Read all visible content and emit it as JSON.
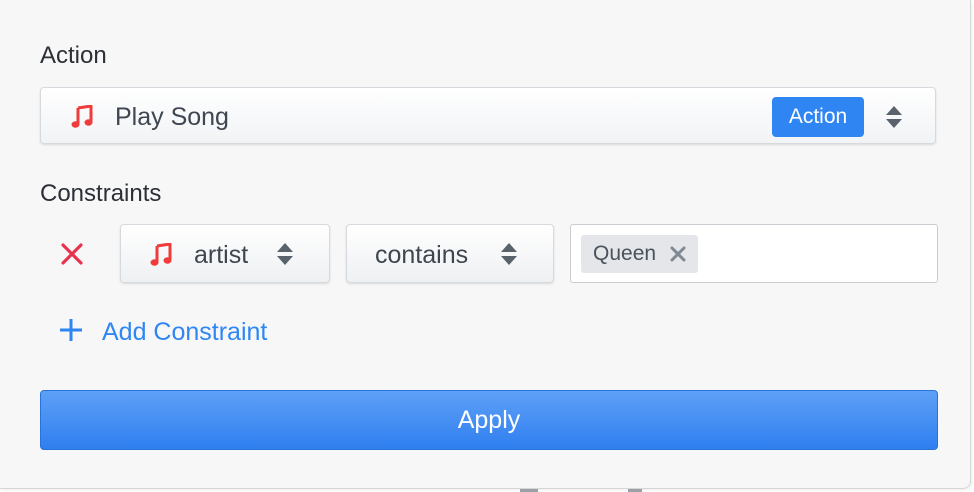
{
  "action_section": {
    "title": "Action",
    "selected": {
      "label": "Play Song",
      "icon": "music-note-icon",
      "badge": "Action"
    }
  },
  "constraints_section": {
    "title": "Constraints",
    "rows": [
      {
        "field": {
          "label": "artist",
          "icon": "music-note-icon"
        },
        "operator": {
          "label": "contains"
        },
        "value_tokens": [
          "Queen"
        ]
      }
    ],
    "add_label": "Add Constraint"
  },
  "apply_label": "Apply",
  "colors": {
    "accent": "#2f86f3",
    "remove": "#e8334f",
    "note": "#ef3b3b",
    "text": "#3e4650"
  }
}
